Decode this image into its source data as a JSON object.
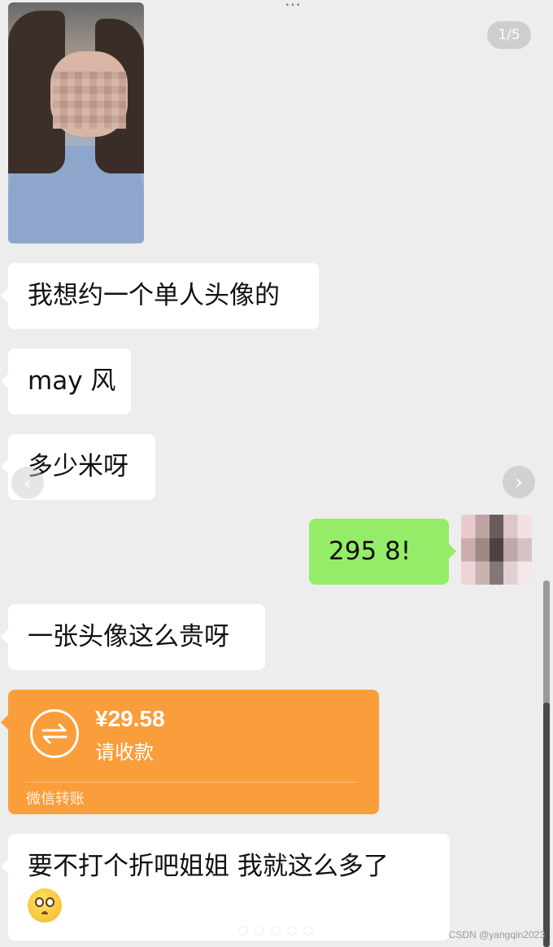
{
  "viewer": {
    "counter": "1/5"
  },
  "header_cut_text": "…",
  "messages": [
    {
      "side": "left",
      "type": "image"
    },
    {
      "side": "left",
      "type": "text",
      "text": "我想约一个单人头像的"
    },
    {
      "side": "left",
      "type": "text",
      "text": "may 风"
    },
    {
      "side": "left",
      "type": "text",
      "text": "多少米呀"
    },
    {
      "side": "right",
      "type": "text",
      "text": "295 8!"
    },
    {
      "side": "left",
      "type": "text",
      "text": "一张头像这么贵呀"
    },
    {
      "side": "left",
      "type": "transfer",
      "amount": "¥29.58",
      "status": "请收款",
      "footer": "微信转账"
    },
    {
      "side": "left",
      "type": "text",
      "text": "要不打个折吧姐姐 我就这么多了",
      "emoji": "pleading-face"
    }
  ],
  "nav": {
    "prev_icon": "‹",
    "next_icon": "›"
  },
  "page_indicator": {
    "count": 5,
    "active": 0
  },
  "watermark": "CSDN @yangqin2023",
  "colors": {
    "background": "#ededed",
    "bubble_left": "#ffffff",
    "bubble_right": "#95ec69",
    "transfer": "#fa9d3b"
  }
}
